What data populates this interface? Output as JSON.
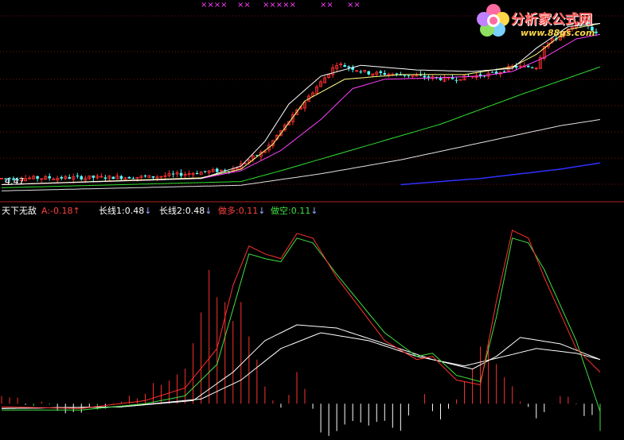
{
  "colors": {
    "background": "#000000",
    "grid": "#7a1010",
    "up": "#ff3030",
    "down": "#54ffff",
    "ma_white": "#ffffff",
    "ma_yellow": "#ffff80",
    "ma_magenta": "#ff40ff",
    "ma_green": "#30e030",
    "ma_gray": "#e0e0e0",
    "ma_blue": "#3030ff",
    "signal_marks": "#ff40ff",
    "indicator_red": "#ff3030",
    "indicator_green": "#40e040",
    "indicator_white": "#ffffff",
    "label_white": "#ffffff",
    "label_red": "#ff4040",
    "label_green": "#40e040",
    "label_arrow_blue": "#9aa8ff"
  },
  "logo": {
    "title": "分析家公式网",
    "url": "www.88gs.com"
  },
  "price_panel": {
    "low_label": "4.47",
    "marks": [
      "××××",
      "××",
      "×××××",
      "××",
      "××"
    ]
  },
  "indicator_panel": {
    "name": "天下无敌",
    "a": {
      "label": "A:",
      "value": "-0.18",
      "arrow": "↑"
    },
    "long1": {
      "label": "长线1:",
      "value": "0.48",
      "arrow": "↓"
    },
    "long2": {
      "label": "长线2:",
      "value": "0.48",
      "arrow": "↓"
    },
    "long_pos": {
      "label": "做多:",
      "value": "0.11",
      "arrow": "↓"
    },
    "short_pos": {
      "label": "做空:",
      "value": "0.11",
      "arrow": "↓"
    }
  },
  "chart_data": {
    "type": "line",
    "price": {
      "anchors": [
        [
          0,
          4.7
        ],
        [
          38,
          4.75
        ],
        [
          58,
          5.0
        ],
        [
          66,
          5.6
        ],
        [
          78,
          7.5
        ],
        [
          84,
          8.4
        ],
        [
          92,
          8.1
        ],
        [
          100,
          8.05
        ],
        [
          112,
          7.9
        ],
        [
          124,
          8.1
        ],
        [
          128,
          8.3
        ],
        [
          134,
          8.3
        ],
        [
          136,
          9.0
        ],
        [
          140,
          9.3
        ],
        [
          146,
          9.8
        ],
        [
          150,
          9.2
        ]
      ],
      "ma_white": [
        [
          0,
          4.5
        ],
        [
          50,
          4.7
        ],
        [
          60,
          5.1
        ],
        [
          66,
          5.9
        ],
        [
          72,
          7.1
        ],
        [
          80,
          8.0
        ],
        [
          90,
          8.35
        ],
        [
          104,
          8.2
        ],
        [
          118,
          8.15
        ],
        [
          128,
          8.25
        ],
        [
          134,
          8.9
        ],
        [
          142,
          9.6
        ],
        [
          150,
          9.7
        ]
      ],
      "ma_yellow": [
        [
          0,
          4.5
        ],
        [
          50,
          4.72
        ],
        [
          60,
          5.0
        ],
        [
          68,
          5.8
        ],
        [
          76,
          7.2
        ],
        [
          86,
          7.9
        ],
        [
          100,
          8.05
        ],
        [
          116,
          8.05
        ],
        [
          128,
          8.3
        ],
        [
          134,
          8.7
        ],
        [
          142,
          9.5
        ],
        [
          150,
          9.7
        ]
      ],
      "ma_magenta": [
        [
          0,
          4.5
        ],
        [
          50,
          4.7
        ],
        [
          60,
          4.95
        ],
        [
          70,
          5.6
        ],
        [
          80,
          6.6
        ],
        [
          88,
          7.6
        ],
        [
          96,
          7.9
        ],
        [
          110,
          7.95
        ],
        [
          120,
          8.0
        ],
        [
          128,
          8.15
        ],
        [
          136,
          8.6
        ],
        [
          144,
          9.2
        ],
        [
          150,
          9.35
        ]
      ],
      "ma_green": [
        [
          0,
          4.4
        ],
        [
          60,
          4.6
        ],
        [
          70,
          4.95
        ],
        [
          90,
          5.7
        ],
        [
          110,
          6.45
        ],
        [
          130,
          7.4
        ],
        [
          150,
          8.3
        ]
      ],
      "ma_gray": [
        [
          0,
          4.3
        ],
        [
          60,
          4.48
        ],
        [
          80,
          4.85
        ],
        [
          100,
          5.3
        ],
        [
          120,
          5.85
        ],
        [
          140,
          6.4
        ],
        [
          150,
          6.6
        ]
      ],
      "ma_blue": [
        [
          100,
          4.5
        ],
        [
          120,
          4.7
        ],
        [
          140,
          5.0
        ],
        [
          150,
          5.2
        ]
      ]
    },
    "indicator": {
      "red_line": [
        [
          0,
          -0.02
        ],
        [
          20,
          -0.03
        ],
        [
          36,
          0.02
        ],
        [
          46,
          0.1
        ],
        [
          54,
          0.35
        ],
        [
          58,
          0.75
        ],
        [
          62,
          1.0
        ],
        [
          66,
          0.95
        ],
        [
          70,
          0.92
        ],
        [
          74,
          1.08
        ],
        [
          78,
          1.05
        ],
        [
          84,
          0.8
        ],
        [
          96,
          0.4
        ],
        [
          104,
          0.28
        ],
        [
          108,
          0.3
        ],
        [
          114,
          0.15
        ],
        [
          120,
          0.12
        ],
        [
          124,
          0.65
        ],
        [
          128,
          1.1
        ],
        [
          132,
          1.05
        ],
        [
          136,
          0.8
        ],
        [
          144,
          0.35
        ],
        [
          150,
          0.2
        ]
      ],
      "green_line": [
        [
          0,
          -0.04
        ],
        [
          20,
          -0.04
        ],
        [
          36,
          0.0
        ],
        [
          46,
          0.05
        ],
        [
          54,
          0.25
        ],
        [
          58,
          0.6
        ],
        [
          62,
          0.95
        ],
        [
          66,
          0.92
        ],
        [
          70,
          0.9
        ],
        [
          74,
          1.05
        ],
        [
          78,
          1.02
        ],
        [
          84,
          0.82
        ],
        [
          96,
          0.45
        ],
        [
          104,
          0.3
        ],
        [
          108,
          0.32
        ],
        [
          114,
          0.18
        ],
        [
          120,
          0.14
        ],
        [
          124,
          0.55
        ],
        [
          128,
          1.05
        ],
        [
          132,
          1.02
        ],
        [
          136,
          0.85
        ],
        [
          144,
          0.4
        ],
        [
          150,
          -0.05
        ]
      ],
      "white1": [
        [
          0,
          -0.03
        ],
        [
          30,
          -0.02
        ],
        [
          48,
          0.02
        ],
        [
          58,
          0.2
        ],
        [
          66,
          0.4
        ],
        [
          74,
          0.5
        ],
        [
          84,
          0.48
        ],
        [
          96,
          0.38
        ],
        [
          108,
          0.28
        ],
        [
          118,
          0.22
        ],
        [
          124,
          0.3
        ],
        [
          130,
          0.42
        ],
        [
          140,
          0.38
        ],
        [
          150,
          0.28
        ]
      ],
      "white2": [
        [
          0,
          -0.03
        ],
        [
          30,
          -0.02
        ],
        [
          50,
          0.03
        ],
        [
          60,
          0.15
        ],
        [
          70,
          0.35
        ],
        [
          80,
          0.45
        ],
        [
          92,
          0.4
        ],
        [
          104,
          0.3
        ],
        [
          116,
          0.24
        ],
        [
          126,
          0.3
        ],
        [
          134,
          0.35
        ],
        [
          144,
          0.32
        ],
        [
          150,
          0.28
        ]
      ],
      "hist": [
        [
          0,
          0.05
        ],
        [
          20,
          -0.06
        ],
        [
          36,
          0.08
        ],
        [
          46,
          0.2
        ],
        [
          50,
          0.6
        ],
        [
          52,
          0.82
        ],
        [
          54,
          0.7
        ],
        [
          58,
          0.55
        ],
        [
          60,
          0.65
        ],
        [
          62,
          0.45
        ],
        [
          66,
          0.1
        ],
        [
          70,
          -0.05
        ],
        [
          74,
          0.2
        ],
        [
          76,
          0.1
        ],
        [
          80,
          -0.2
        ],
        [
          90,
          -0.1
        ],
        [
          100,
          -0.15
        ],
        [
          106,
          0.05
        ],
        [
          110,
          -0.1
        ],
        [
          116,
          0.12
        ],
        [
          120,
          0.35
        ],
        [
          122,
          0.4
        ],
        [
          126,
          0.15
        ],
        [
          130,
          0.02
        ],
        [
          134,
          -0.1
        ],
        [
          140,
          0.05
        ],
        [
          146,
          -0.05
        ],
        [
          150,
          -0.15
        ]
      ]
    }
  }
}
